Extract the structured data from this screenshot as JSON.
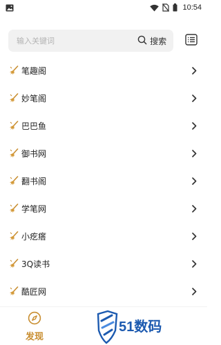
{
  "status_bar": {
    "time": "10:54",
    "icons": [
      "image-icon",
      "wifi-icon",
      "no-sim-icon",
      "battery-icon"
    ]
  },
  "search": {
    "placeholder": "输入关键词",
    "button_label": "搜索"
  },
  "sources": [
    {
      "name": "笔趣阁"
    },
    {
      "name": "妙笔阁"
    },
    {
      "name": "巴巴鱼"
    },
    {
      "name": "御书网"
    },
    {
      "name": "翻书阁"
    },
    {
      "name": "学笔网"
    },
    {
      "name": "小疙瘩"
    },
    {
      "name": "3Q读书"
    },
    {
      "name": "酷匠网"
    }
  ],
  "bottom_nav": {
    "discover_label": "发现"
  },
  "watermark": {
    "text": "51数码"
  },
  "colors": {
    "accent": "#c88d2f",
    "watermark_blue": "#1c5ab0",
    "search_bg": "#f1f1f1",
    "placeholder": "#b3b3b3"
  }
}
